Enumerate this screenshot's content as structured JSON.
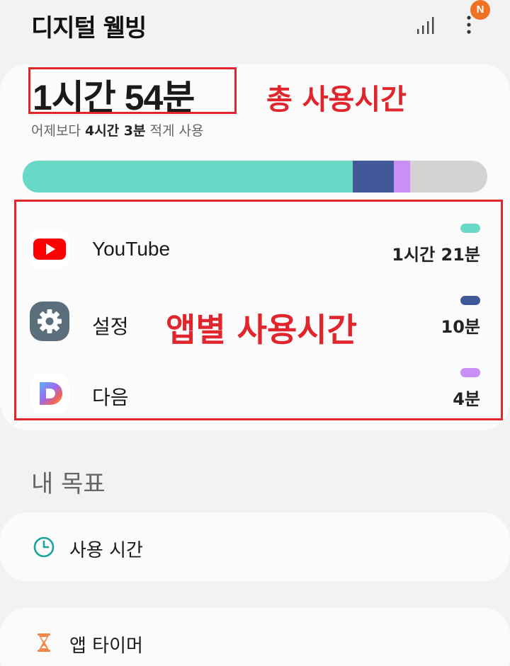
{
  "header": {
    "title": "디지털 웰빙",
    "notification_badge": "N",
    "icons": [
      "stats-icon",
      "more-vert-icon"
    ]
  },
  "summary": {
    "total_time": "1시간 54분",
    "comparison_prefix": "어제보다 ",
    "comparison_value": "4시간 3분",
    "comparison_suffix": " 적게 사용"
  },
  "annotations": {
    "total_label": "총 사용시간",
    "apps_label": "앱별 사용시간"
  },
  "usage_bar": {
    "unit": "min",
    "total_minutes": 114,
    "segments": [
      {
        "app": "YouTube",
        "minutes": 81,
        "color": "#68d9c6"
      },
      {
        "app": "설정",
        "minutes": 10,
        "color": "#415899"
      },
      {
        "app": "다음",
        "minutes": 4,
        "color": "#c98ff4"
      }
    ],
    "remainder_color": "#d3d3d3"
  },
  "apps": [
    {
      "name": "YouTube",
      "time": "1시간 21분",
      "color": "#68d9c6",
      "icon": "youtube-icon"
    },
    {
      "name": "설정",
      "time": "10분",
      "color": "#415899",
      "icon": "settings-gear-icon"
    },
    {
      "name": "다음",
      "time": "4분",
      "color": "#c98ff4",
      "icon": "daum-icon"
    }
  ],
  "goals": {
    "section_title": "내 목표",
    "items": [
      {
        "label": "사용 시간",
        "icon": "clock-icon",
        "accent": "#1aa39a"
      },
      {
        "label": "앱 타이머",
        "icon": "hourglass-icon",
        "accent": "#ef8a4c"
      }
    ]
  },
  "colors": {
    "annotation_red": "#e0252c",
    "background": "#f2f2f2",
    "card": "#fbfbfb"
  }
}
